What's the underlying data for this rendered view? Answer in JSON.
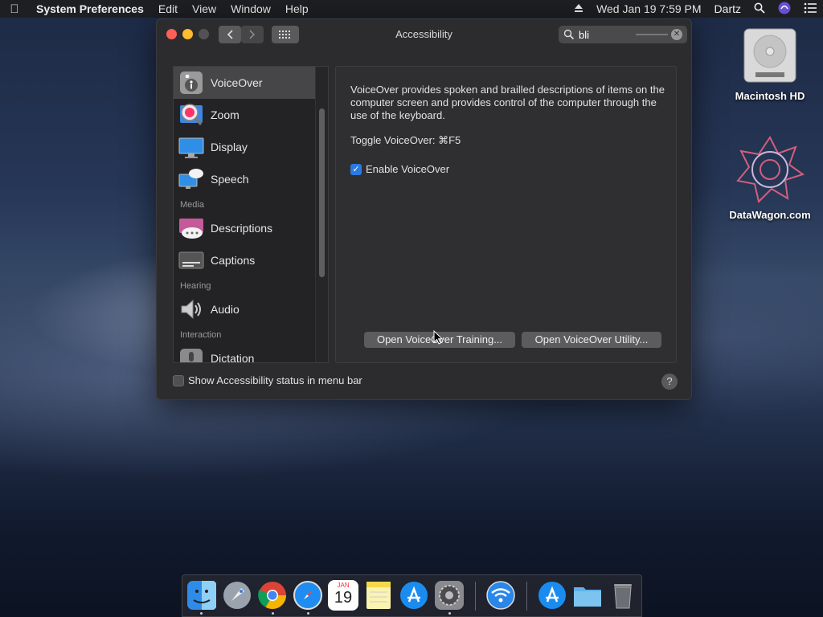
{
  "menubar": {
    "app_name": "System Preferences",
    "menus": [
      "Edit",
      "View",
      "Window",
      "Help"
    ],
    "datetime": "Wed Jan 19  7:59 PM",
    "user": "Dartz"
  },
  "window": {
    "title": "Accessibility",
    "search_value": "bli"
  },
  "sidebar": {
    "items": [
      {
        "label": "VoiceOver",
        "icon": "voiceover-icon",
        "selected": true
      },
      {
        "label": "Zoom",
        "icon": "zoom-icon"
      },
      {
        "label": "Display",
        "icon": "display-icon"
      },
      {
        "label": "Speech",
        "icon": "speech-icon"
      },
      {
        "section": "Media"
      },
      {
        "label": "Descriptions",
        "icon": "descriptions-icon"
      },
      {
        "label": "Captions",
        "icon": "captions-icon"
      },
      {
        "section": "Hearing"
      },
      {
        "label": "Audio",
        "icon": "audio-icon"
      },
      {
        "section": "Interaction"
      },
      {
        "label": "Dictation",
        "icon": "dictation-icon"
      }
    ]
  },
  "content": {
    "description": "VoiceOver provides spoken and brailled descriptions of items on the computer screen and provides control of the computer through the use of the keyboard.",
    "toggle_label": "Toggle VoiceOver:  ⌘F5",
    "enable_label": "Enable VoiceOver",
    "enable_checked": true,
    "training_button": "Open VoiceOver Training...",
    "utility_button": "Open VoiceOver Utility..."
  },
  "footer": {
    "status_label": "Show Accessibility status in menu bar",
    "status_checked": false,
    "help": "?"
  },
  "desktop": {
    "hd_label": "Macintosh HD",
    "datawagon_label": "DataWagon.com"
  },
  "calendar": {
    "month": "JAN",
    "day": "19"
  },
  "colors": {
    "accent": "#2a7ae3",
    "window_bg": "#2c2c2e",
    "sidebar_selected": "#464648"
  },
  "dock": [
    "finder-icon",
    "launchpad-icon",
    "chrome-icon",
    "safari-icon",
    "calendar-icon",
    "notes-icon",
    "app-store-icon",
    "system-preferences-icon",
    "wifi-icon",
    "app-store-folder-icon",
    "documents-folder-icon",
    "trash-icon"
  ]
}
